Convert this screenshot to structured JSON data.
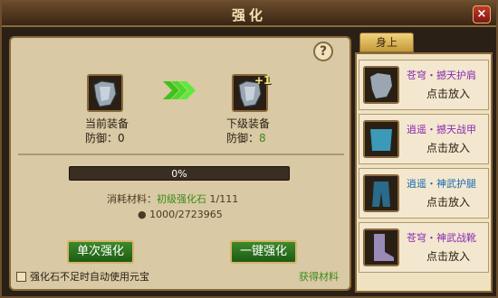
{
  "window": {
    "title": "强化",
    "close": "×"
  },
  "help": "?",
  "current": {
    "label": "当前装备",
    "def_label": "防御：",
    "def_value": "0"
  },
  "next": {
    "label": "下级装备",
    "def_label": "防御：",
    "def_value": "8",
    "level": "+1"
  },
  "progress": {
    "text": "0%",
    "fraction": 0
  },
  "material": {
    "prefix": "消耗材料：",
    "name": "初级强化石",
    "count": "1/111"
  },
  "gold": {
    "text": "1000/2723965"
  },
  "buttons": {
    "single": "单次强化",
    "one_key": "一键强化"
  },
  "auto": {
    "label": "强化石不足时自动使用元宝"
  },
  "get_material": "获得材料",
  "side": {
    "tab": "身上",
    "items": [
      {
        "name": "苍穹・撼天护肩",
        "action": "点击放入"
      },
      {
        "name": "逍遥・撼天战甲",
        "action": "点击放入"
      },
      {
        "name": "逍遥・神武护腿",
        "action": "点击放入"
      },
      {
        "name": "苍穹・神武战靴",
        "action": "点击放入"
      }
    ]
  }
}
